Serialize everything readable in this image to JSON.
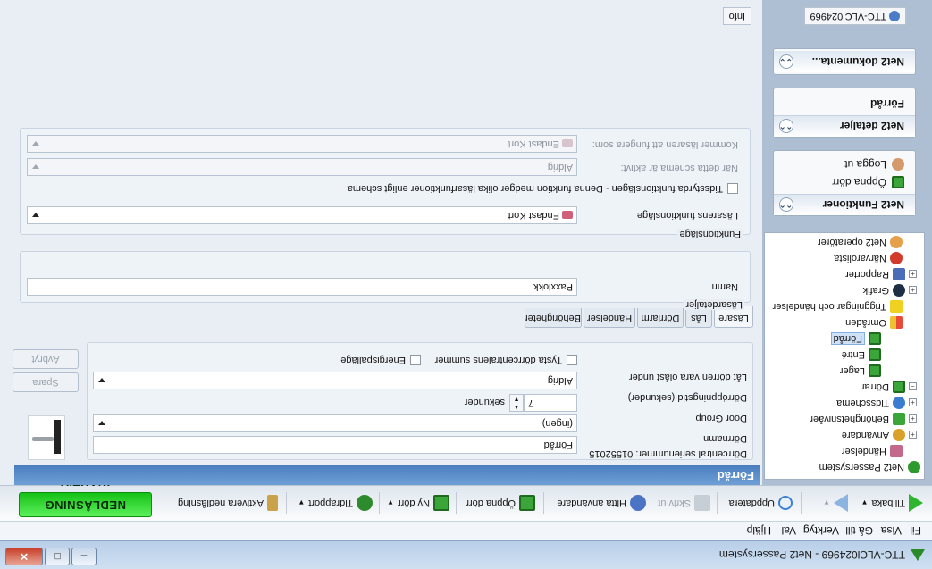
{
  "window": {
    "title": "TTC-VLCl024969 - Net2 Passersystem",
    "minimize": "–",
    "maximize": "□",
    "close": "✕"
  },
  "menu": [
    "Fil",
    "Visa",
    "Gå till",
    "Verktyg",
    "Val",
    "Hjälp"
  ],
  "toolbar": {
    "back": "Tillbaka",
    "refresh": "Uppdatera",
    "print": "Skriv ut",
    "find_user": "Hitta användare",
    "open_door": "Öppna dörr",
    "new_door": "Ny dörr",
    "time_report": "Tidrapport",
    "activate_lock": "Aktivera nedlåsning",
    "lock_status": "NEDLÅSNING INAKTIV"
  },
  "sidebar": {
    "tree": [
      {
        "label": "Net2 Passersystem",
        "icon": "system-icon",
        "expander": ""
      },
      {
        "label": "Händelser",
        "icon": "events-icon",
        "expander": ""
      },
      {
        "label": "Användare",
        "icon": "users-icon",
        "expander": "+"
      },
      {
        "label": "Behörighetsnivåer",
        "icon": "access-levels-icon",
        "expander": "+"
      },
      {
        "label": "Tidsschema",
        "icon": "timezone-icon",
        "expander": "+"
      },
      {
        "label": "Dörrar",
        "icon": "doors-icon",
        "expander": "−"
      },
      {
        "label": "Lager",
        "icon": "door-icon",
        "expander": "",
        "indent": 2
      },
      {
        "label": "Entré",
        "icon": "door-icon",
        "expander": "",
        "indent": 2
      },
      {
        "label": "Förråd",
        "icon": "door-icon",
        "expander": "",
        "indent": 2,
        "selected": true
      },
      {
        "label": "Områden",
        "icon": "areas-icon",
        "expander": ""
      },
      {
        "label": "Triggningar och händelser",
        "icon": "triggers-icon",
        "expander": ""
      },
      {
        "label": "Grafik",
        "icon": "eye-icon",
        "expander": "+"
      },
      {
        "label": "Rapporter",
        "icon": "reports-icon",
        "expander": "+"
      },
      {
        "label": "Närvarolista",
        "icon": "roll-call-icon",
        "expander": ""
      },
      {
        "label": "Net2 operatörer",
        "icon": "operators-icon",
        "expander": ""
      }
    ],
    "functions": {
      "title": "Net2 Funktioner",
      "items": [
        "Öppna dörr",
        "Logga ut"
      ]
    },
    "details": {
      "title": "Net2 detaljer",
      "items": [
        "Förråd"
      ]
    },
    "documents": {
      "title": "Net2 dokumenta..."
    }
  },
  "main": {
    "header": "Förråd",
    "serial": "Dörrcentral serienummer: 01552015",
    "door_name_label": "Dörrnamn",
    "door_name_value": "Förråd",
    "door_group_label": "Door Group",
    "door_group_value": "(ingen)",
    "open_time_label": "Dörröppningstid (sekunder)",
    "open_time_value": "7",
    "open_time_unit": "sekunder",
    "leave_unlocked_label": "Låt dörren vara olåst under",
    "leave_unlocked_value": "Aldrig",
    "silence_alarm": "Tysta dörrcentralens summer",
    "energy_save": "Energispalläge",
    "save_button": "Spara",
    "cancel_button": "Avbryt",
    "tabs": [
      "Läsare",
      "Lås",
      "Dörrlarm",
      "Händelser",
      "Behörigheter"
    ],
    "reader_details_title": "Läsardetaljer",
    "name_label": "Namn",
    "name_value": "Paxxlokk",
    "function_mode_title": "Funktionsläge",
    "reader_function_label": "Läsarens funktionsläge",
    "reader_function_value": "Endast Kort",
    "timed_function_label": "Tidsstyrda funktionslägen - Denna funktion medger olika läsarfunktioner enligt schema",
    "schedule_active_label": "När detta schema är aktivt:",
    "schedule_active_value": "Aldrig",
    "reader_mode_label": "Kommer läsaren att fungera som:",
    "reader_mode_value": "Endast Kort",
    "status_info": "Info",
    "status_host": "TTC-VLCl024969"
  }
}
